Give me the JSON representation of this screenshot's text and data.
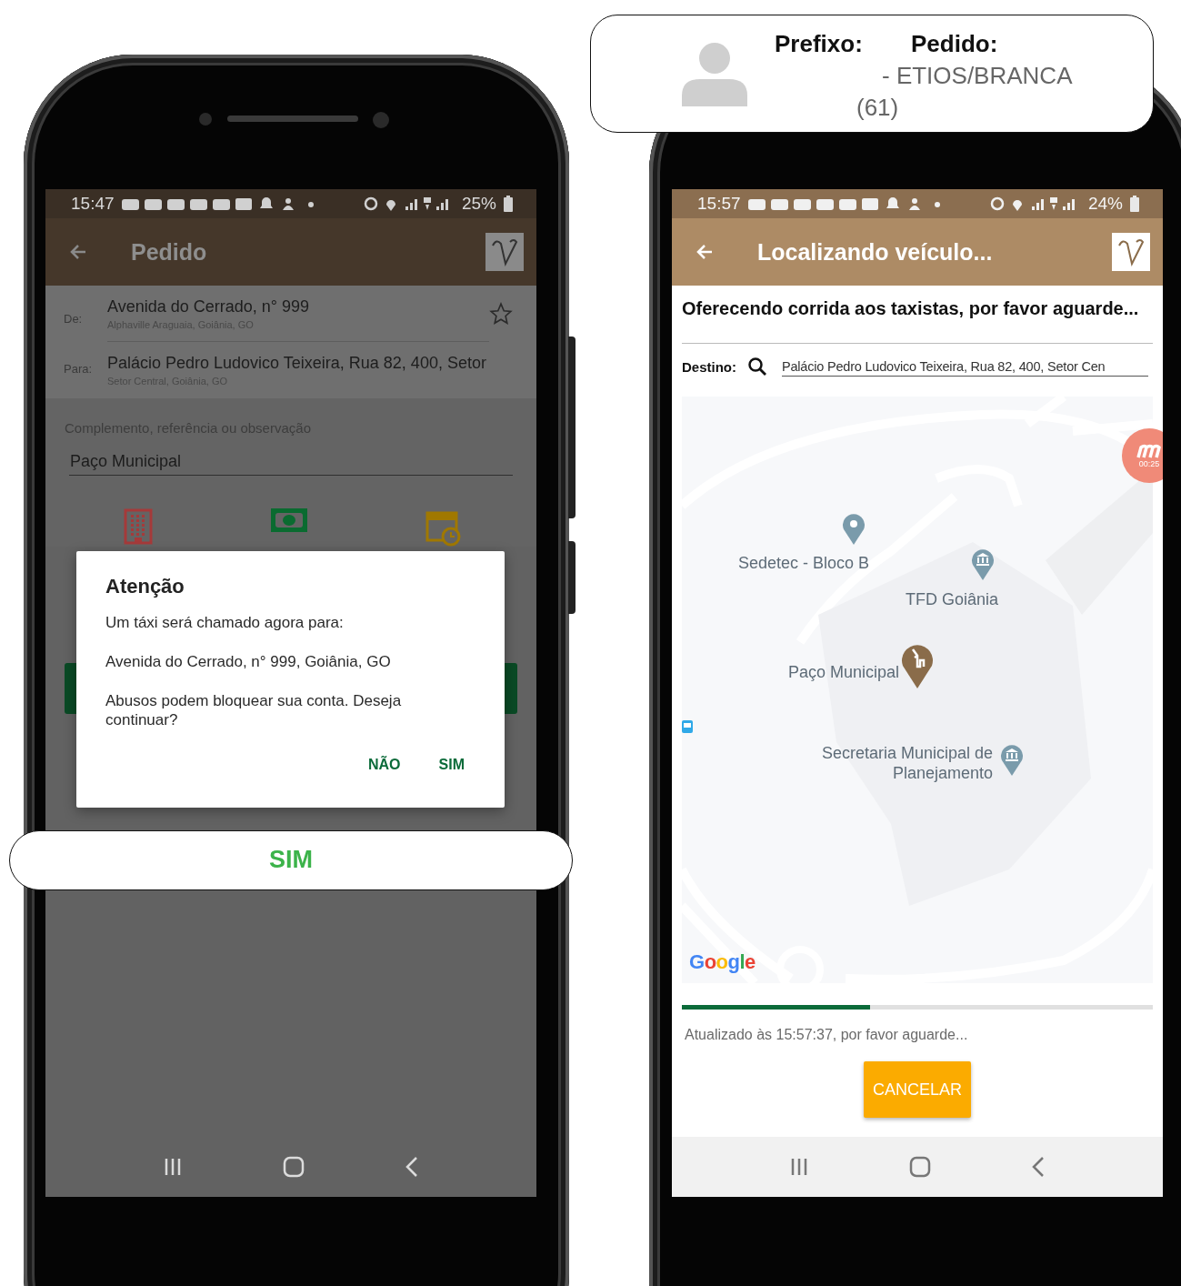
{
  "left_phone": {
    "status_bar": {
      "time": "15:47",
      "battery": "25%"
    },
    "app_bar": {
      "title": "Pedido"
    },
    "route": {
      "from_label": "De:",
      "from_address": "Avenida do Cerrado, n° 999",
      "from_detail": "Alphaville Araguaia, Goiânia, GO",
      "to_label": "Para:",
      "to_address": "Palácio Pedro Ludovico Teixeira, Rua 82, 400, Setor",
      "to_detail": "Setor Central, Goiânia, GO"
    },
    "complement": {
      "label": "Complemento, referência ou observação",
      "value": "Paço Municipal"
    },
    "dialog": {
      "title": "Atenção",
      "lines": [
        "Um táxi será chamado agora para:",
        "Avenida do Cerrado, n° 999, Goiânia, GO",
        "Abusos podem bloquear sua conta. Deseja continuar?"
      ],
      "buttons": [
        "NÃO",
        "SIM"
      ]
    }
  },
  "right_phone": {
    "status_bar": {
      "time": "15:57",
      "battery": "24%"
    },
    "app_bar": {
      "title": "Localizando veículo..."
    },
    "heading": "Oferecendo corrida aos taxistas, por favor aguarde...",
    "destination": {
      "label": "Destino:",
      "value": "Palácio Pedro Ludovico Teixeira, Rua 82, 400, Setor Cen"
    },
    "map": {
      "places": [
        {
          "label": "Sedetec - Bloco B",
          "kind": "pin"
        },
        {
          "label": "TFD Goiânia",
          "kind": "civic"
        },
        {
          "label": "Paço Municipal",
          "kind": "taxi"
        },
        {
          "label": "Secretaria Municipal de Planejamento",
          "kind": "civic"
        }
      ],
      "timer": "00:25",
      "attribution": "Google"
    },
    "progress": {
      "level": 0.4
    },
    "updated": "Atualizado às 15:57:37, por favor aguarde...",
    "cancel_button": "CANCELAR"
  },
  "driver_callout": {
    "prefix_label": "Prefixo:",
    "order_label": "Pedido:",
    "vehicle": "- ETIOS/BRANCA",
    "phone": "(61)"
  },
  "answer_callout": {
    "label": "SIM"
  }
}
